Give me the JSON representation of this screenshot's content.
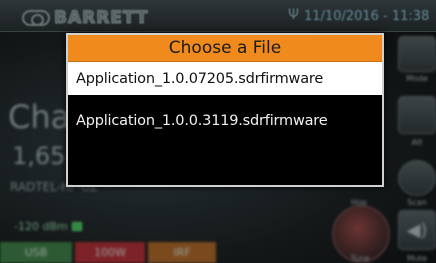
{
  "status_bar": {
    "brand": "BARRETT",
    "datetime": "11/10/2016 - 11:38",
    "usb_icon": "usb-icon"
  },
  "background": {
    "channel_title": "Cha",
    "frequency": "1,65",
    "radio_model": "RADTEL-HF-UZ",
    "signal_level": "-120 dBm",
    "tags": {
      "mode": "USB",
      "power": "100W",
      "filter": "IRF"
    },
    "side_labels": {
      "mode": "Mode",
      "alt": "Alt",
      "hop": "Hop",
      "scan": "Scan",
      "tune": "Tune",
      "mute": "Mute"
    }
  },
  "dialog": {
    "title": "Choose a File",
    "files": [
      {
        "name": "Application_1.0.07205.sdrfirmware",
        "selected": true
      },
      {
        "name": "Application_1.0.0.3119.sdrfirmware",
        "selected": false
      }
    ]
  },
  "colors": {
    "dialog_header": "#f08a1d",
    "selected_row": "#ffffff",
    "dialog_background": "#000000",
    "mode_tag": "#2d5a33",
    "power_tag": "#7d2226",
    "filter_tag": "#7a4a1e"
  }
}
